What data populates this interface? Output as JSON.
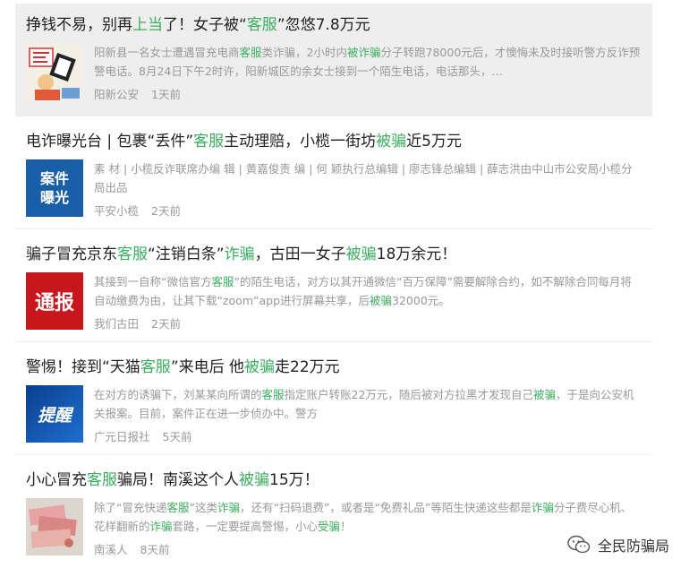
{
  "items": [
    {
      "title": [
        {
          "t": "挣钱不易，别再"
        },
        {
          "t": "上当",
          "g": true
        },
        {
          "t": "了！女子被“"
        },
        {
          "t": "客服",
          "g": true
        },
        {
          "t": "”忽悠7.8万元"
        }
      ],
      "desc": [
        {
          "t": "阳新县一名女士遭遇冒充电商"
        },
        {
          "t": "客服",
          "g": true
        },
        {
          "t": "类诈骗，2小时内"
        },
        {
          "t": "被诈骗",
          "g": true
        },
        {
          "t": "分子转跑78000元后，才懊悔未及时接听警方反诈预警电话。8月24日下午2时许，阳新城区的余女士接到一个陌生电话，电话那头，…"
        }
      ],
      "source": "阳新公安",
      "time": "1天前",
      "thumb": "cartoon-illustration"
    },
    {
      "title": [
        {
          "t": "电诈曝光台 | 包裹“丢件”"
        },
        {
          "t": "客服",
          "g": true
        },
        {
          "t": "主动理赔，小榄一街坊"
        },
        {
          "t": "被骗",
          "g": true
        },
        {
          "t": "近5万元"
        }
      ],
      "desc": [
        {
          "t": "素 材 | 小榄反诈联席办编 辑 | 黄嘉俊责 编 | 何 颖执行总编辑 | 廖志锋总编辑 | 薛志洪由中山市公安局小榄分局出品"
        }
      ],
      "source": "平安小榄",
      "time": "2天前",
      "thumb": "案件\n曝光"
    },
    {
      "title": [
        {
          "t": "骗子冒充京东"
        },
        {
          "t": "客服",
          "g": true
        },
        {
          "t": "“注销白条”"
        },
        {
          "t": "诈骗",
          "g": true
        },
        {
          "t": "，古田一女子"
        },
        {
          "t": "被骗",
          "g": true
        },
        {
          "t": "18万余元！"
        }
      ],
      "desc": [
        {
          "t": "其接到一自称“微信官方"
        },
        {
          "t": "客服",
          "g": true
        },
        {
          "t": "”的陌生电话，对方以其开通微信“百万保障”需要解除合约，如不解除合同每月将自动缴费为由，让其下载“zoom”app进行屏幕共享，后"
        },
        {
          "t": "被骗",
          "g": true
        },
        {
          "t": "32000元。"
        }
      ],
      "source": "我们古田",
      "time": "2天前",
      "thumb": "通报"
    },
    {
      "title": [
        {
          "t": "警惕！接到“天猫"
        },
        {
          "t": "客服",
          "g": true
        },
        {
          "t": "”来电后 他"
        },
        {
          "t": "被骗",
          "g": true
        },
        {
          "t": "走22万元"
        }
      ],
      "desc": [
        {
          "t": "在对方的诱骗下，刘某某向所谓的"
        },
        {
          "t": "客服",
          "g": true
        },
        {
          "t": "指定账户转账22万元，随后被对方拉黑才发现自己"
        },
        {
          "t": "被骗",
          "g": true
        },
        {
          "t": "，于是向公安机关报案。目前，案件正在进一步侦办中。警方"
        }
      ],
      "source": "广元日报社",
      "time": "5天前",
      "thumb": "提醒"
    },
    {
      "title": [
        {
          "t": "小心冒充"
        },
        {
          "t": "客服",
          "g": true
        },
        {
          "t": "骗局！南溪这个人"
        },
        {
          "t": "被骗",
          "g": true
        },
        {
          "t": "15万！"
        }
      ],
      "desc": [
        {
          "t": "除了“冒充快递"
        },
        {
          "t": "客服",
          "g": true
        },
        {
          "t": "”这类"
        },
        {
          "t": "诈骗",
          "g": true
        },
        {
          "t": "，还有“扫码退费”，或者是“免费礼品”等陌生快递这些都是"
        },
        {
          "t": "诈骗",
          "g": true
        },
        {
          "t": "分子费尽心机、花样翻新的"
        },
        {
          "t": "诈骗",
          "g": true
        },
        {
          "t": "套路，一定要提高警惕，小心"
        },
        {
          "t": "受骗",
          "g": true
        },
        {
          "t": "！"
        }
      ],
      "source": "南溪人",
      "time": "8天前",
      "thumb": "banknotes-photo"
    }
  ],
  "watermark": "全民防骗局",
  "colors": {
    "keyword": "#3cae5f",
    "meta": "#999999"
  }
}
